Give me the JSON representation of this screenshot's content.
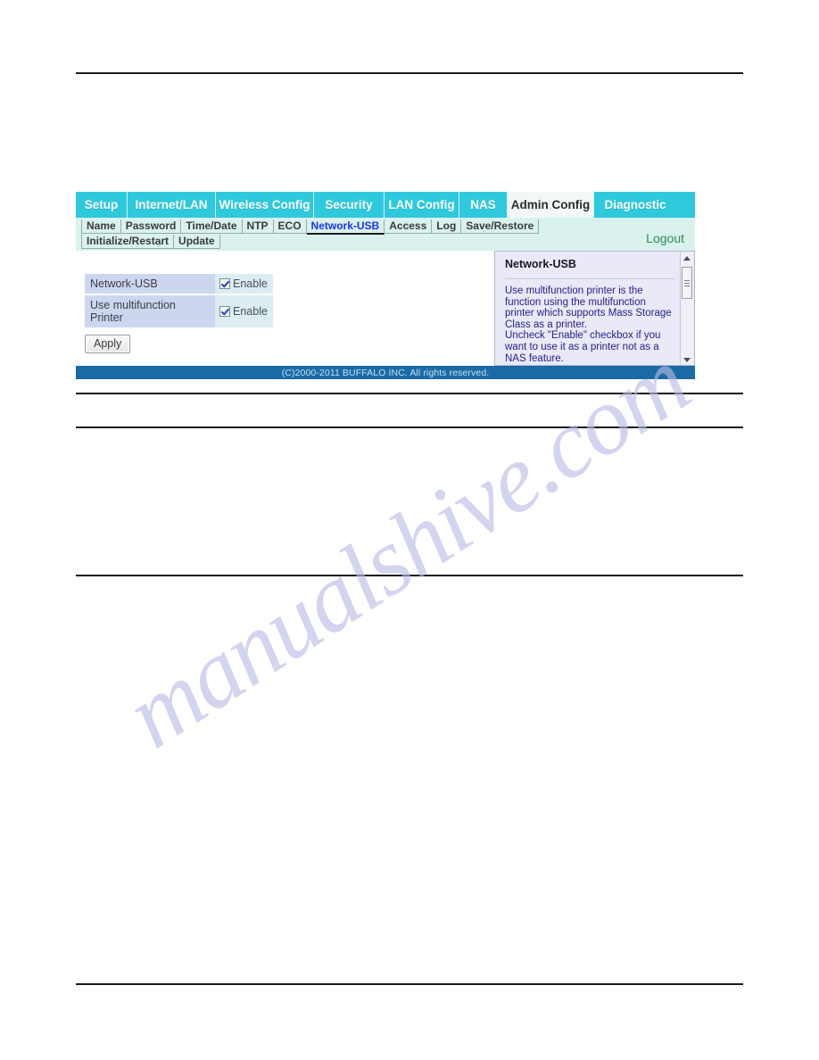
{
  "watermark": {
    "text": "manualshive.com"
  },
  "router_ui": {
    "main_tabs": [
      {
        "label": "Setup",
        "active": false
      },
      {
        "label": "Internet/LAN",
        "active": false
      },
      {
        "label": "Wireless Config",
        "active": false
      },
      {
        "label": "Security",
        "active": false
      },
      {
        "label": "LAN Config",
        "active": false
      },
      {
        "label": "NAS",
        "active": false
      },
      {
        "label": "Admin Config",
        "active": true
      },
      {
        "label": "Diagnostic",
        "active": false
      }
    ],
    "sub_tabs_row1": [
      {
        "label": "Name",
        "active": false
      },
      {
        "label": "Password",
        "active": false
      },
      {
        "label": "Time/Date",
        "active": false
      },
      {
        "label": "NTP",
        "active": false
      },
      {
        "label": "ECO",
        "active": false
      },
      {
        "label": "Network-USB",
        "active": true
      },
      {
        "label": "Access",
        "active": false
      },
      {
        "label": "Log",
        "active": false
      },
      {
        "label": "Save/Restore",
        "active": false
      }
    ],
    "sub_tabs_row2": [
      {
        "label": "Initialize/Restart",
        "active": false
      },
      {
        "label": "Update",
        "active": false
      }
    ],
    "logout_label": "Logout",
    "settings": [
      {
        "label": "Network-USB",
        "checkbox_label": "Enable",
        "checked": true
      },
      {
        "label": "Use multifunction Printer",
        "checkbox_label": "Enable",
        "checked": true
      }
    ],
    "apply_label": "Apply",
    "help": {
      "title": "Network-USB",
      "body": "Use multifunction printer is the function using the multifunction printer which supports Mass Storage Class as a printer.\nUncheck \"Enable\" checkbox if you want to use it as a printer not as a NAS feature."
    },
    "footer": "(C)2000-2011 BUFFALO INC. All rights reserved.",
    "colors": {
      "tab_cyan": "#2ec9dd",
      "tab_active_bg": "#f2f8f8",
      "subtab_bar": "#d9f2ee",
      "label_bg": "#ccd7ef",
      "value_bg": "#dcecf0",
      "help_bg": "#e9e9f7",
      "help_text": "#22228e",
      "footer_bg": "#1a6ba5",
      "logout_green": "#2f8a4f",
      "active_subtab_blue": "#1a33ee"
    }
  }
}
